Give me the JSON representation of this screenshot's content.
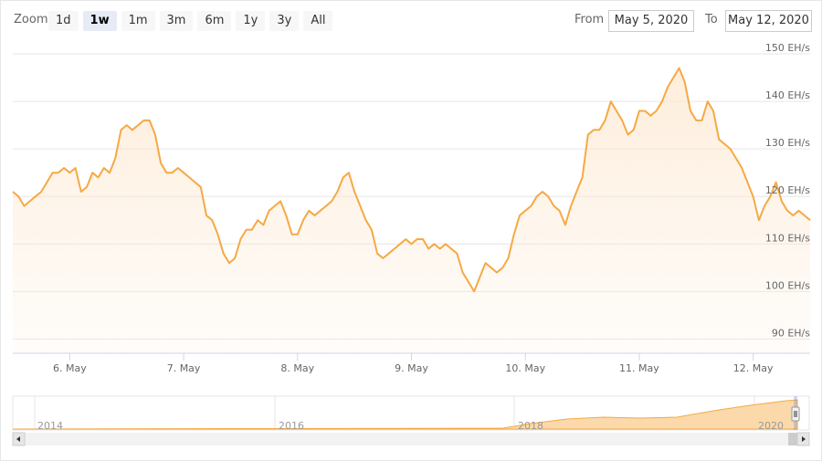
{
  "toolbar": {
    "zoom_label": "Zoom",
    "zoom_buttons": [
      {
        "label": "1d",
        "active": false
      },
      {
        "label": "1w",
        "active": true
      },
      {
        "label": "1m",
        "active": false
      },
      {
        "label": "3m",
        "active": false
      },
      {
        "label": "6m",
        "active": false
      },
      {
        "label": "1y",
        "active": false
      },
      {
        "label": "3y",
        "active": false
      },
      {
        "label": "All",
        "active": false
      }
    ],
    "from_label": "From",
    "from_value": "May 5, 2020",
    "to_label": "To",
    "to_value": "May 12, 2020"
  },
  "navigator": {
    "year_labels": [
      "2014",
      "2016",
      "2018",
      "2020"
    ],
    "scroll_left_icon": "arrow-left-icon",
    "scroll_right_icon": "arrow-right-icon",
    "handle_icon": "range-handle-icon"
  },
  "colors": {
    "line": "#f5a944",
    "fill_top": "#fde8d0",
    "grid": "#e6e6e6",
    "axis": "#ccd6eb"
  },
  "chart_data": {
    "type": "area",
    "x_unit": "May 2020 (day, fractional)",
    "ylabel": "",
    "y_tick_labels": [
      "90 EH/s",
      "100 EH/s",
      "110 EH/s",
      "120 EH/s",
      "130 EH/s",
      "140 EH/s",
      "150 EH/s"
    ],
    "y_ticks": [
      90,
      100,
      110,
      120,
      130,
      140,
      150
    ],
    "x_tick_labels": [
      "6. May",
      "7. May",
      "8. May",
      "9. May",
      "10. May",
      "11. May",
      "12. May"
    ],
    "x_ticks": [
      6,
      7,
      8,
      9,
      10,
      11,
      12
    ],
    "xlim": [
      5.5,
      12.5
    ],
    "ylim": [
      87,
      150
    ],
    "grid": true,
    "series": [
      {
        "x": [
          5.5,
          5.55,
          5.6,
          5.65,
          5.7,
          5.75,
          5.8,
          5.85,
          5.9,
          5.95,
          6.0,
          6.05,
          6.1,
          6.15,
          6.2,
          6.25,
          6.3,
          6.35,
          6.4,
          6.45,
          6.5,
          6.55,
          6.6,
          6.65,
          6.7,
          6.75,
          6.8,
          6.85,
          6.9,
          6.95,
          7.0,
          7.05,
          7.1,
          7.15,
          7.2,
          7.25,
          7.3,
          7.35,
          7.4,
          7.45,
          7.5,
          7.55,
          7.6,
          7.65,
          7.7,
          7.75,
          7.8,
          7.85,
          7.9,
          7.95,
          8.0,
          8.05,
          8.1,
          8.15,
          8.2,
          8.25,
          8.3,
          8.35,
          8.4,
          8.45,
          8.5,
          8.55,
          8.6,
          8.65,
          8.7,
          8.75,
          8.8,
          8.85,
          8.9,
          8.95,
          9.0,
          9.05,
          9.1,
          9.15,
          9.2,
          9.25,
          9.3,
          9.35,
          9.4,
          9.45,
          9.5,
          9.55,
          9.6,
          9.65,
          9.7,
          9.75,
          9.8,
          9.85,
          9.9,
          9.95,
          10.0,
          10.05,
          10.1,
          10.15,
          10.2,
          10.25,
          10.3,
          10.35,
          10.4,
          10.45,
          10.5,
          10.55,
          10.6,
          10.65,
          10.7,
          10.75,
          10.8,
          10.85,
          10.9,
          10.95,
          11.0,
          11.05,
          11.1,
          11.15,
          11.2,
          11.25,
          11.3,
          11.35,
          11.4,
          11.45,
          11.5,
          11.55,
          11.6,
          11.65,
          11.7,
          11.75,
          11.8,
          11.85,
          11.9,
          11.95,
          12.0,
          12.05,
          12.1,
          12.15,
          12.2,
          12.25,
          12.3,
          12.35,
          12.4,
          12.45,
          12.5
        ],
        "values": [
          121,
          120,
          118,
          119,
          120,
          121,
          123,
          125,
          125,
          126,
          125,
          126,
          121,
          122,
          125,
          124,
          126,
          125,
          128,
          134,
          135,
          134,
          135,
          136,
          136,
          133,
          127,
          125,
          125,
          126,
          125,
          124,
          123,
          122,
          116,
          115,
          112,
          108,
          106,
          107,
          111,
          113,
          113,
          115,
          114,
          117,
          118,
          119,
          116,
          112,
          112,
          115,
          117,
          116,
          117,
          118,
          119,
          121,
          124,
          125,
          121,
          118,
          115,
          113,
          108,
          107,
          108,
          109,
          110,
          111,
          110,
          111,
          111,
          109,
          110,
          109,
          110,
          109,
          108,
          104,
          102,
          100,
          103,
          106,
          105,
          104,
          105,
          107,
          112,
          116,
          117,
          118,
          120,
          121,
          120,
          118,
          117,
          114,
          118,
          121,
          124,
          133,
          134,
          134,
          136,
          140,
          138,
          136,
          133,
          134,
          138,
          138,
          137,
          138,
          140,
          143,
          145,
          147,
          144,
          138,
          136,
          136,
          140,
          138,
          132,
          131,
          130,
          128,
          126,
          123,
          120,
          115,
          118,
          120,
          123,
          119,
          117,
          116,
          117,
          116,
          115
        ]
      }
    ]
  }
}
